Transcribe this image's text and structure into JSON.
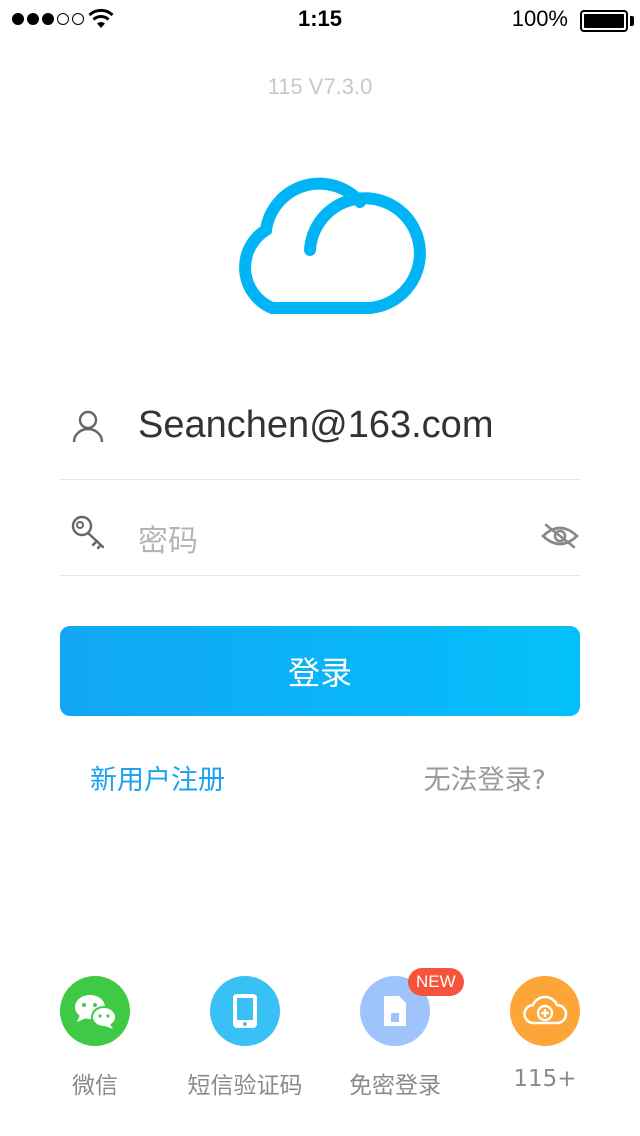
{
  "status_bar": {
    "time": "1:15",
    "battery_percent": "100%"
  },
  "app": {
    "version": "115 V7.3.0"
  },
  "login_form": {
    "username_value": "Seanchen@163.com",
    "password_placeholder": "密码",
    "login_label": "登录"
  },
  "links": {
    "register": "新用户注册",
    "cant_login": "无法登录?"
  },
  "login_options": [
    {
      "label": "微信",
      "icon": "wechat-icon",
      "color": "#3fca45"
    },
    {
      "label": "短信验证码",
      "icon": "phone-icon",
      "color": "#39c0f5"
    },
    {
      "label": "免密登录",
      "icon": "sim-card-icon",
      "color": "#9fc3fb",
      "badge": "NEW"
    },
    {
      "label": "115+",
      "icon": "cloud-plus-icon",
      "color": "#fda638"
    }
  ],
  "colors": {
    "accent": "#12a6f5",
    "logo": "#00b4f5",
    "link": "#1ba3ef",
    "badge": "#f5543a"
  }
}
